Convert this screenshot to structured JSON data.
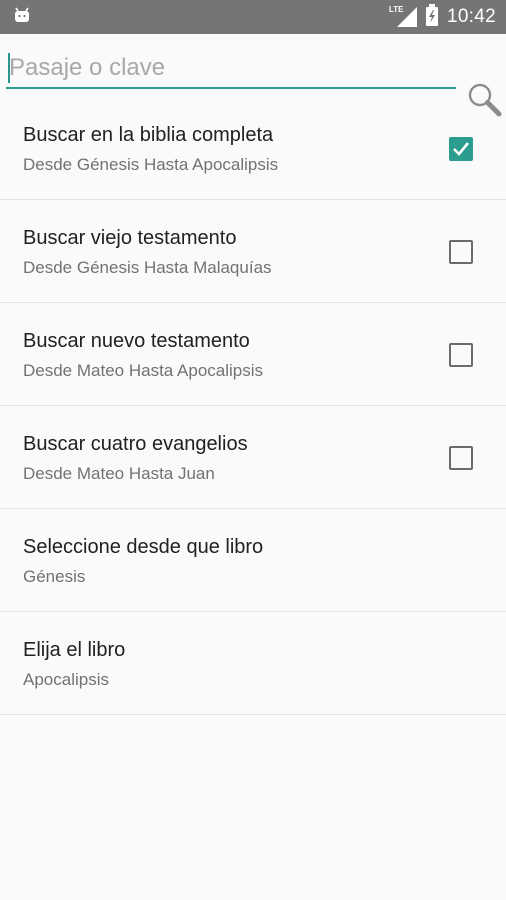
{
  "status_bar": {
    "time": "10:42",
    "network": "LTE",
    "icons": [
      "android-notification-icon",
      "lte-signal-icon",
      "battery-icon"
    ]
  },
  "search": {
    "placeholder": "Pasaje o clave",
    "value": "",
    "button_icon": "search-icon"
  },
  "options": [
    {
      "title": "Buscar en la biblia completa",
      "subtitle": "Desde Génesis Hasta Apocalipsis",
      "checked": true
    },
    {
      "title": "Buscar viejo testamento",
      "subtitle": "Desde Génesis Hasta Malaquías",
      "checked": false
    },
    {
      "title": "Buscar nuevo testamento",
      "subtitle": "Desde Mateo Hasta Apocalipsis",
      "checked": false
    },
    {
      "title": "Buscar cuatro evangelios",
      "subtitle": "Desde Mateo Hasta Juan",
      "checked": false
    }
  ],
  "selectors": [
    {
      "title": "Seleccione desde que libro",
      "value": "Génesis"
    },
    {
      "title": "Elija el libro",
      "value": "Apocalipsis"
    }
  ],
  "colors": {
    "accent": "#2a9d8f",
    "status_bar": "#757575",
    "background": "#fafafa"
  }
}
